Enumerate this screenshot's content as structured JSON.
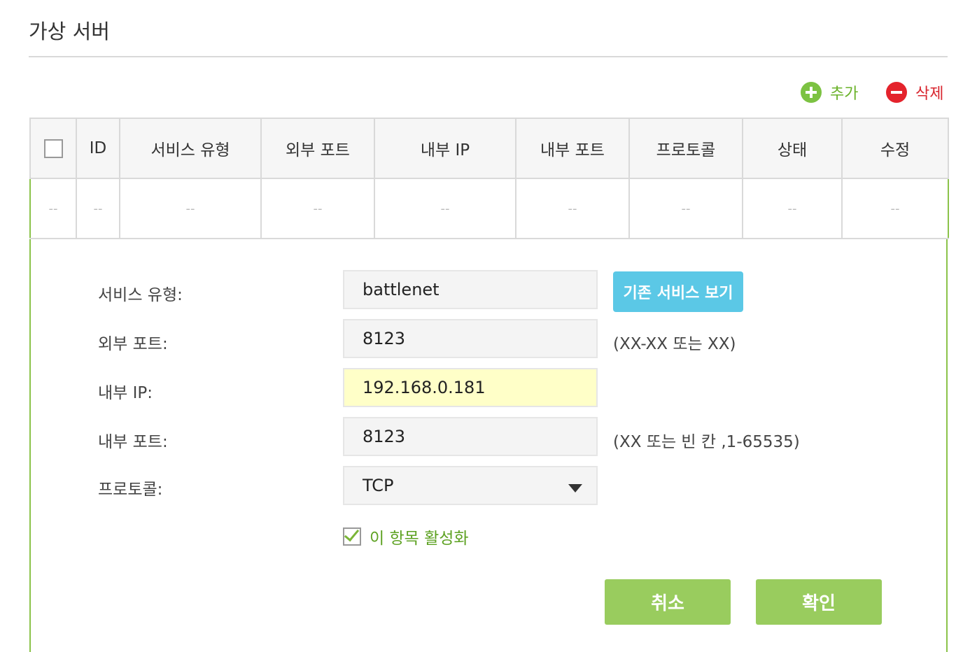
{
  "page": {
    "title": "가상 서버"
  },
  "toolbar": {
    "add_label": "추가",
    "delete_label": "삭제"
  },
  "table": {
    "headers": [
      "ID",
      "서비스 유형",
      "외부 포트",
      "내부 IP",
      "내부 포트",
      "프로토콜",
      "상태",
      "수정"
    ],
    "row": [
      "--",
      "--",
      "--",
      "--",
      "--",
      "--",
      "--",
      "--",
      "--"
    ]
  },
  "form": {
    "service_type_label": "서비스 유형:",
    "service_type_value": "battlenet",
    "existing_service_button": "기존 서비스 보기",
    "external_port_label": "외부 포트:",
    "external_port_value": "8123",
    "external_port_hint": "(XX-XX 또는 XX)",
    "internal_ip_label": "내부 IP:",
    "internal_ip_value": "192.168.0.181",
    "internal_port_label": "내부 포트:",
    "internal_port_value": "8123",
    "internal_port_hint": "(XX 또는 빈 칸 ,1-65535)",
    "protocol_label": "프로토콜:",
    "protocol_value": "TCP",
    "enable_label": "이 항목 활성화",
    "enable_checked": true,
    "cancel_label": "취소",
    "confirm_label": "확인"
  },
  "colors": {
    "accent_green": "#8bc34a",
    "add_green": "#7cc242",
    "delete_red": "#e4232c",
    "info_blue": "#5bc8e6",
    "highlight_yellow": "#ffffc8"
  }
}
